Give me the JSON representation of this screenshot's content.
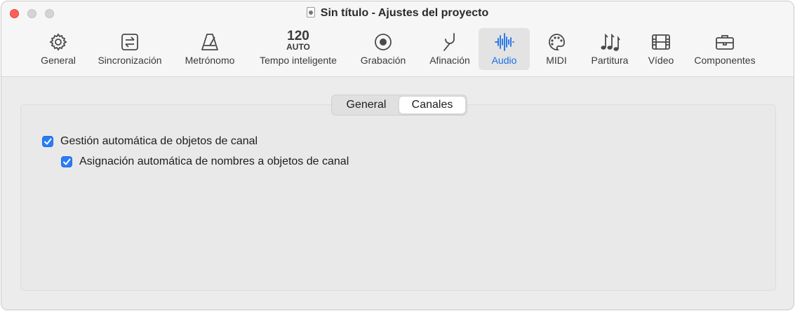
{
  "window": {
    "title": "Sin título - Ajustes del proyecto",
    "doc_icon": "logic-project-icon"
  },
  "toolbar": {
    "items": [
      {
        "label": "General",
        "icon": "gear-icon"
      },
      {
        "label": "Sincronización",
        "icon": "sync-icon"
      },
      {
        "label": "Metrónomo",
        "icon": "metronome-icon"
      },
      {
        "label": "Tempo inteligente",
        "icon": "tempo-icon",
        "tempo_value": "120",
        "tempo_mode": "AUTO"
      },
      {
        "label": "Grabación",
        "icon": "record-icon"
      },
      {
        "label": "Afinación",
        "icon": "tuning-fork-icon"
      },
      {
        "label": "Audio",
        "icon": "waveform-icon",
        "active": true
      },
      {
        "label": "MIDI",
        "icon": "midi-icon"
      },
      {
        "label": "Partitura",
        "icon": "music-notes-icon"
      },
      {
        "label": "Vídeo",
        "icon": "film-icon"
      },
      {
        "label": "Componentes",
        "icon": "briefcase-icon"
      }
    ],
    "active_color": "#1a6fe8"
  },
  "tabs": {
    "items": [
      "General",
      "Canales"
    ],
    "selected": "Canales"
  },
  "options": {
    "auto_channel_objects": {
      "label": "Gestión automática de objetos de canal",
      "checked": true
    },
    "auto_channel_naming": {
      "label": "Asignación automática de nombres a objetos de canal",
      "checked": true
    }
  },
  "colors": {
    "checkbox": "#2b7cf4",
    "close": "#fe5f57"
  }
}
